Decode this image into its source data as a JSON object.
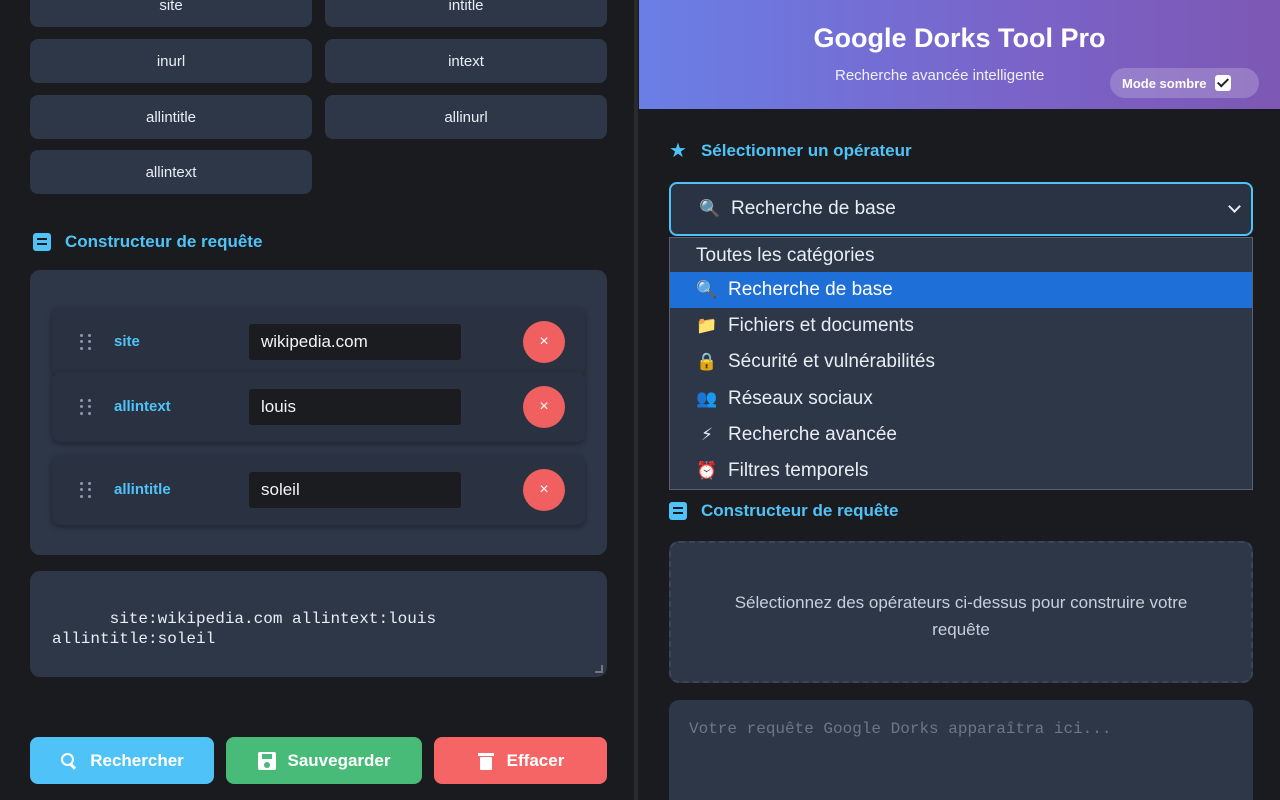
{
  "left": {
    "operators": [
      {
        "label": "site"
      },
      {
        "label": "intitle"
      },
      {
        "label": "inurl"
      },
      {
        "label": "intext"
      },
      {
        "label": "allintitle"
      },
      {
        "label": "allinurl"
      },
      {
        "label": "allintext"
      }
    ],
    "builder_title": "Constructeur de requête",
    "query_rows": [
      {
        "operator": "site",
        "value": "wikipedia.com",
        "remove": "×"
      },
      {
        "operator": "allintext",
        "value": "louis",
        "remove": "×"
      },
      {
        "operator": "allintitle",
        "value": "soleil",
        "remove": "×"
      }
    ],
    "query_text": "site:wikipedia.com allintext:louis\nallintitle:soleil",
    "actions": {
      "search": "Rechercher",
      "save": "Sauvegarder",
      "clear": "Effacer"
    },
    "colors": {
      "search": "#4fc3f7",
      "save": "#48bb78",
      "clear": "#f56565",
      "accent": "#4fc3f7"
    }
  },
  "right": {
    "title": "Google Dorks Tool Pro",
    "subtitle": "Recherche avancée intelligente",
    "dark_mode_label": "Mode sombre",
    "dark_mode_checked": true,
    "select_section_title": "Sélectionner un opérateur",
    "select_value": "Recherche de base",
    "select_icon": "🔍",
    "dropdown_options": [
      {
        "icon": "",
        "label": "Toutes les catégories"
      },
      {
        "icon": "🔍",
        "label": "Recherche de base",
        "selected": true
      },
      {
        "icon": "📁",
        "label": "Fichiers et documents"
      },
      {
        "icon": "🔒",
        "label": "Sécurité et vulnérabilités"
      },
      {
        "icon": "👥",
        "label": "Réseaux sociaux"
      },
      {
        "icon": "⚡",
        "label": "Recherche avancée"
      },
      {
        "icon": "⏰",
        "label": "Filtres temporels"
      }
    ],
    "builder_title": "Constructeur de requête",
    "builder_empty": "Sélectionnez des opérateurs ci-dessus pour construire votre requête",
    "query_placeholder": "Votre requête Google Dorks apparaîtra ici..."
  }
}
